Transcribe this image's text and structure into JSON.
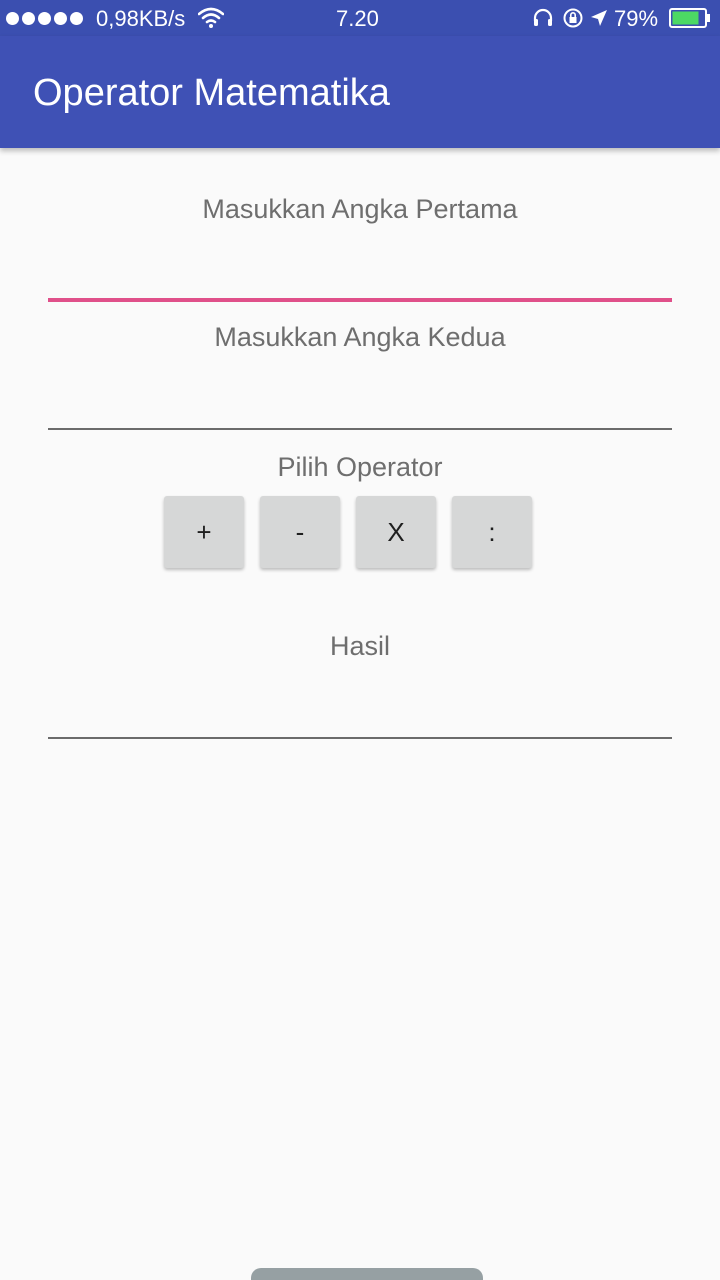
{
  "status_bar": {
    "net_speed": "0,98KB/s",
    "time": "7.20",
    "battery": "79%",
    "icons": [
      "signal-dots-icon",
      "wifi-icon",
      "headset-icon",
      "rotation-lock-icon",
      "location-arrow-icon",
      "battery-icon"
    ]
  },
  "app_bar": {
    "title": "Operator Matematika",
    "color": "#3f51b5"
  },
  "form": {
    "first_label": "Masukkan Angka Pertama",
    "first_value": "",
    "second_label": "Masukkan Angka Kedua",
    "second_value": "",
    "operator_label": "Pilih Operator",
    "operators": [
      "+",
      "-",
      "X",
      ":"
    ],
    "result_label": "Hasil",
    "result_value": ""
  },
  "colors": {
    "accent": "#e0508a",
    "status_bar": "#3b4fb0"
  }
}
